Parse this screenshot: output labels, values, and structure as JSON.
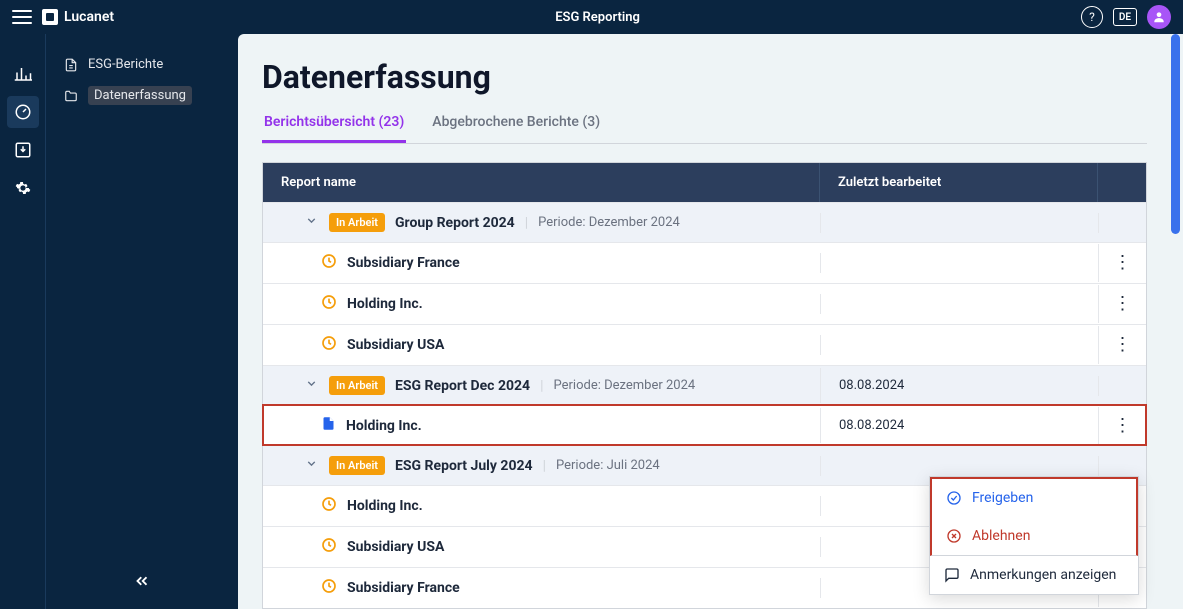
{
  "header": {
    "app": "Lucanet",
    "title": "ESG Reporting",
    "lang": "DE"
  },
  "sidebar": {
    "items": [
      {
        "label": "ESG-Berichte",
        "icon": "document-icon"
      },
      {
        "label": "Datenerfassung",
        "icon": "folder-icon",
        "active": true
      }
    ]
  },
  "page": {
    "title": "Datenerfassung"
  },
  "tabs": [
    {
      "label": "Berichtsübersicht (23)",
      "active": true
    },
    {
      "label": "Abgebrochene Berichte (3)"
    }
  ],
  "table": {
    "columns": {
      "name": "Report name",
      "date": "Zuletzt bearbeitet"
    },
    "rows": [
      {
        "type": "group",
        "badge": "In Arbeit",
        "name": "Group Report 2024",
        "period": "Periode: Dezember 2024",
        "date": ""
      },
      {
        "type": "sub",
        "icon": "clock",
        "name": "Subsidiary France",
        "date": "",
        "actions": true
      },
      {
        "type": "sub",
        "icon": "clock",
        "name": "Holding Inc.",
        "date": "",
        "actions": true
      },
      {
        "type": "sub",
        "icon": "clock",
        "name": "Subsidiary USA",
        "date": "",
        "actions": true
      },
      {
        "type": "group",
        "badge": "In Arbeit",
        "name": "ESG Report Dec 2024",
        "period": "Periode: Dezember 2024",
        "date": "08.08.2024"
      },
      {
        "type": "sub",
        "icon": "doc",
        "name": "Holding Inc.",
        "date": "08.08.2024",
        "actions": true,
        "highlight": true
      },
      {
        "type": "group",
        "badge": "In Arbeit",
        "name": "ESG Report July 2024",
        "period": "Periode: Juli 2024",
        "date": ""
      },
      {
        "type": "sub",
        "icon": "clock",
        "name": "Holding Inc.",
        "date": "",
        "actions": true
      },
      {
        "type": "sub",
        "icon": "clock",
        "name": "Subsidiary USA",
        "date": "",
        "actions": true
      },
      {
        "type": "sub",
        "icon": "clock",
        "name": "Subsidiary France",
        "date": "",
        "actions": true
      }
    ]
  },
  "menu": {
    "approve": "Freigeben",
    "reject": "Ablehnen",
    "notes": "Anmerkungen anzeigen"
  }
}
